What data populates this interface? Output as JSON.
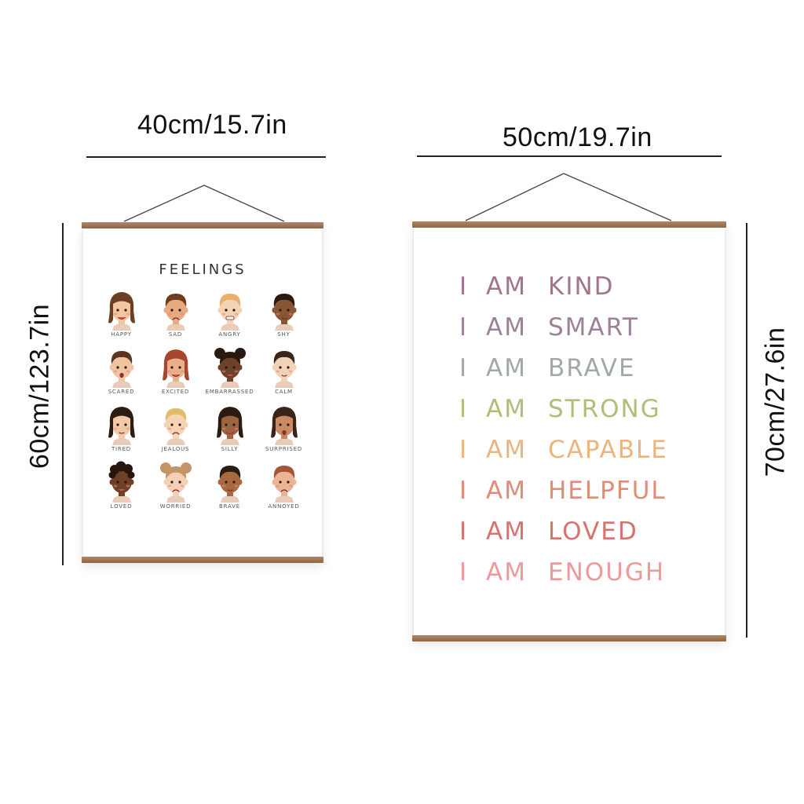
{
  "dimensions": {
    "poster1_width": "40cm/15.7in",
    "poster1_height": "60cm/123.7in",
    "poster2_width": "50cm/19.7in",
    "poster2_height": "70cm/27.6in"
  },
  "poster1": {
    "title": "FEELINGS",
    "faces": [
      {
        "label": "HAPPY",
        "skin": "#f1c6a0",
        "hair": "#6b3f26",
        "hair_style": "long",
        "mouth": "smile"
      },
      {
        "label": "SAD",
        "skin": "#e8ab7f",
        "hair": "#6e3d20",
        "hair_style": "short",
        "mouth": "frown"
      },
      {
        "label": "ANGRY",
        "skin": "#f4d2b4",
        "hair": "#e7b06f",
        "hair_style": "short",
        "mouth": "grit"
      },
      {
        "label": "SHY",
        "skin": "#8a5535",
        "hair": "#2b1a12",
        "hair_style": "short",
        "mouth": "small"
      },
      {
        "label": "SCARED",
        "skin": "#f0c4a0",
        "hair": "#5a3522",
        "hair_style": "short",
        "mouth": "open"
      },
      {
        "label": "EXCITED",
        "skin": "#e9b08a",
        "hair": "#a8462d",
        "hair_style": "long",
        "mouth": "smile"
      },
      {
        "label": "EMBARRASSED",
        "skin": "#6e4129",
        "hair": "#2a1910",
        "hair_style": "buns",
        "mouth": "smile"
      },
      {
        "label": "CALM",
        "skin": "#f3d3b7",
        "hair": "#3a2618",
        "hair_style": "short",
        "mouth": "small"
      },
      {
        "label": "TIRED",
        "skin": "#f2c9a8",
        "hair": "#2b1c14",
        "hair_style": "long",
        "mouth": "small"
      },
      {
        "label": "JEALOUS",
        "skin": "#f5d3b5",
        "hair": "#e3bb6d",
        "hair_style": "short",
        "mouth": "frown"
      },
      {
        "label": "SILLY",
        "skin": "#9c6441",
        "hair": "#2a1a11",
        "hair_style": "long",
        "mouth": "smile"
      },
      {
        "label": "SURPRISED",
        "skin": "#c88a63",
        "hair": "#3b2417",
        "hair_style": "long",
        "mouth": "open"
      },
      {
        "label": "LOVED",
        "skin": "#6f3f26",
        "hair": "#26160f",
        "hair_style": "curly",
        "mouth": "smile"
      },
      {
        "label": "WORRIED",
        "skin": "#f4d1b6",
        "hair": "#c39467",
        "hair_style": "buns",
        "mouth": "frown"
      },
      {
        "label": "BRAVE",
        "skin": "#a8693f",
        "hair": "#2b1b11",
        "hair_style": "short",
        "mouth": "small"
      },
      {
        "label": "ANNOYED",
        "skin": "#eab595",
        "hair": "#a25539",
        "hair_style": "short",
        "mouth": "frown"
      }
    ]
  },
  "poster2": {
    "lines": [
      {
        "i": "I",
        "am": "AM",
        "word": "KIND",
        "color": "#a0758e"
      },
      {
        "i": "I",
        "am": "AM",
        "word": "SMART",
        "color": "#9d8198"
      },
      {
        "i": "I",
        "am": "AM",
        "word": "BRAVE",
        "color": "#a2aaa8"
      },
      {
        "i": "I",
        "am": "AM",
        "word": "STRONG",
        "color": "#b5bb7a"
      },
      {
        "i": "I",
        "am": "AM",
        "word": "CAPABLE",
        "color": "#ebb57f"
      },
      {
        "i": "I",
        "am": "AM",
        "word": "HELPFUL",
        "color": "#df8c79"
      },
      {
        "i": "I",
        "am": "AM",
        "word": "LOVED",
        "color": "#d7736f"
      },
      {
        "i": "I",
        "am": "AM",
        "word": "ENOUGH",
        "color": "#ec9a9a"
      }
    ]
  }
}
